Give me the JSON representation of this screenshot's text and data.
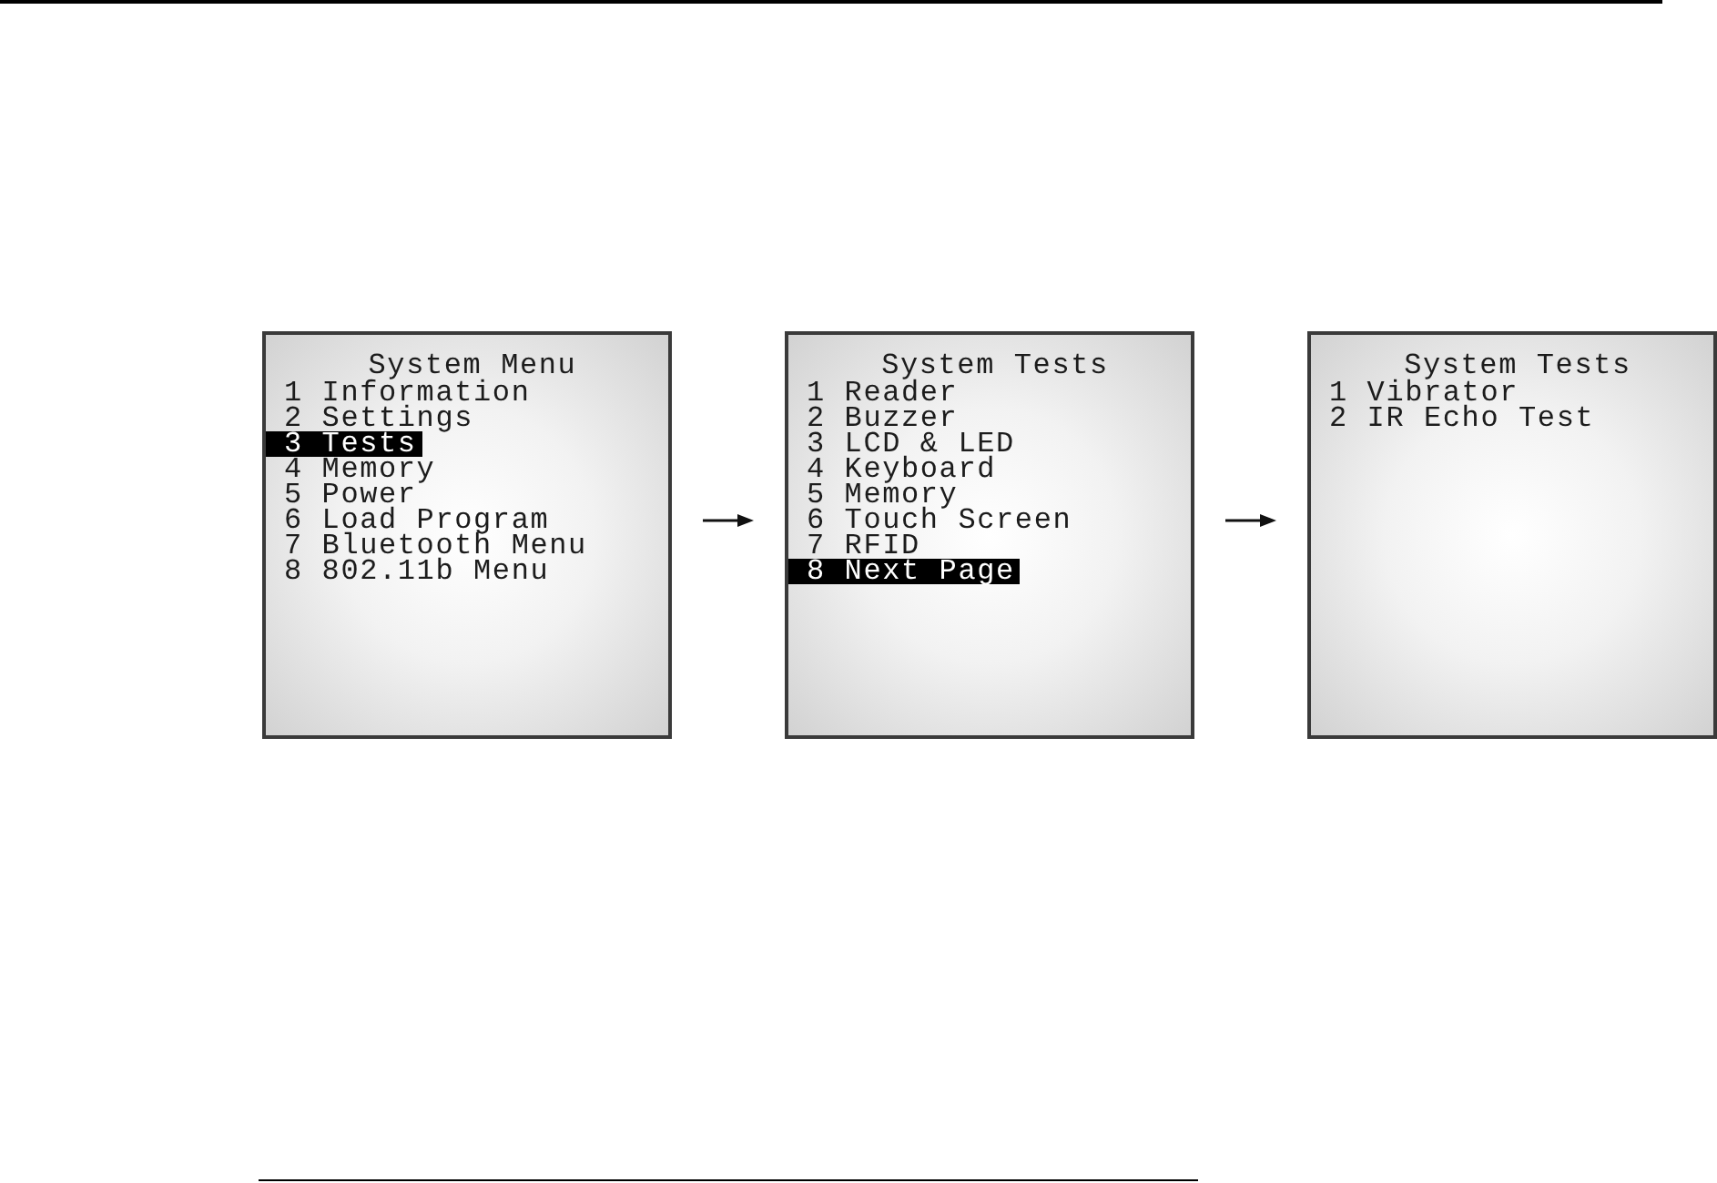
{
  "screens": [
    {
      "title": "System Menu",
      "items": [
        {
          "label": "1 Information",
          "selected": false
        },
        {
          "label": "2 Settings",
          "selected": false
        },
        {
          "label": "3 Tests",
          "selected": true
        },
        {
          "label": "4 Memory",
          "selected": false
        },
        {
          "label": "5 Power",
          "selected": false
        },
        {
          "label": "6 Load Program",
          "selected": false
        },
        {
          "label": "7 Bluetooth Menu",
          "selected": false
        },
        {
          "label": "8 802.11b Menu",
          "selected": false
        }
      ]
    },
    {
      "title": "System Tests",
      "items": [
        {
          "label": "1 Reader",
          "selected": false
        },
        {
          "label": "2 Buzzer",
          "selected": false
        },
        {
          "label": "3 LCD & LED",
          "selected": false
        },
        {
          "label": "4 Keyboard",
          "selected": false
        },
        {
          "label": "5 Memory",
          "selected": false
        },
        {
          "label": "6 Touch Screen",
          "selected": false
        },
        {
          "label": "7 RFID",
          "selected": false
        },
        {
          "label": "8 Next Page",
          "selected": true
        }
      ]
    },
    {
      "title": "System Tests",
      "items": [
        {
          "label": "1 Vibrator",
          "selected": false
        },
        {
          "label": "2 IR Echo Test",
          "selected": false
        }
      ]
    }
  ]
}
